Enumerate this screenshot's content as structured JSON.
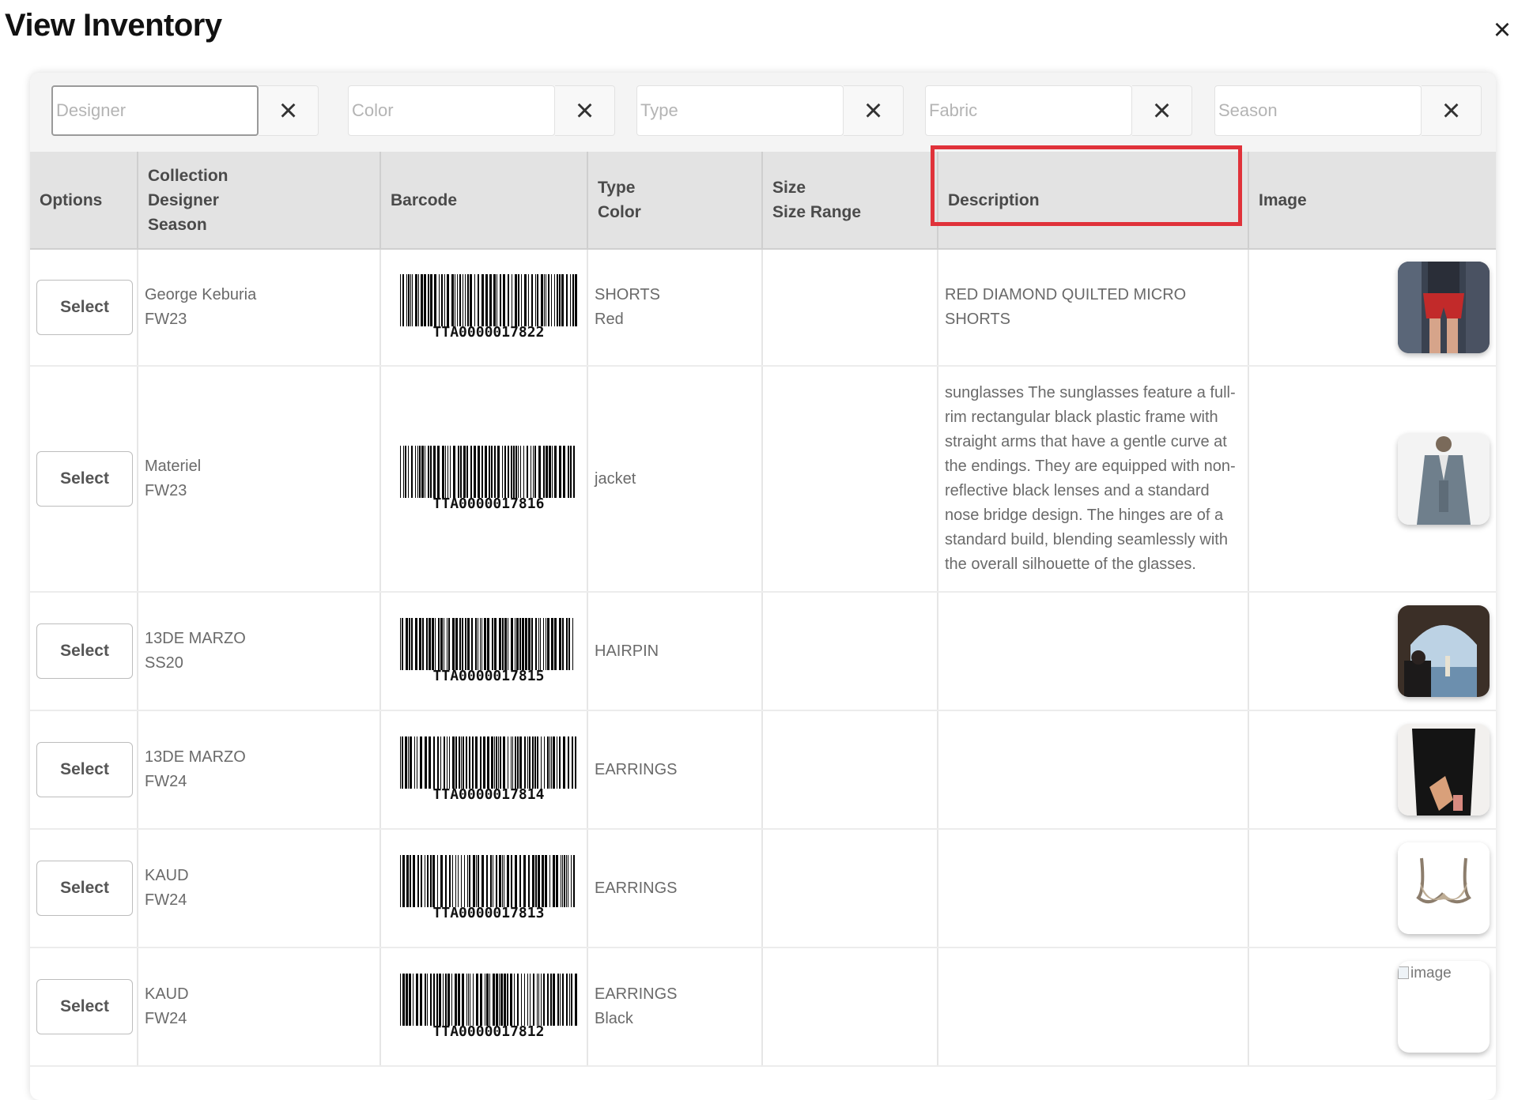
{
  "dialog": {
    "title": "View Inventory",
    "close_icon": "×"
  },
  "filters": [
    {
      "placeholder": "Designer",
      "clear_icon": "×",
      "active": true
    },
    {
      "placeholder": "Color",
      "clear_icon": "×"
    },
    {
      "placeholder": "Type",
      "clear_icon": "×"
    },
    {
      "placeholder": "Fabric",
      "clear_icon": "×",
      "highlighted": true
    },
    {
      "placeholder": "Season",
      "clear_icon": "×"
    }
  ],
  "table": {
    "headers": {
      "options": "Options",
      "collection": [
        "Collection",
        "Designer",
        "Season"
      ],
      "barcode": "Barcode",
      "type_color": [
        "Type",
        "Color"
      ],
      "size": [
        "Size",
        "Size Range"
      ],
      "description": "Description",
      "image": "Image"
    },
    "select_label": "Select",
    "rows": [
      {
        "designer": "George Keburia",
        "season": "FW23",
        "barcode": "TTA0000017822",
        "type": "SHORTS",
        "color": "Red",
        "description": "RED DIAMOND QUILTED MICRO SHORTS",
        "image": "runway-red-shorts"
      },
      {
        "designer": "Materiel",
        "season": "FW23",
        "barcode": "TTA0000017816",
        "type": "jacket",
        "color": "",
        "description": "sunglasses The sunglasses feature a full-rim rectangular black plastic frame with straight arms that have a gentle curve at the endings. They are equipped with non-reflective black lenses and a standard nose bridge design. The hinges are of a standard build, blending seamlessly with the overall silhouette of the glasses.",
        "image": "grey-blazer-model"
      },
      {
        "designer": "13DE MARZO",
        "season": "SS20",
        "barcode": "TTA0000017815",
        "type": "HAIRPIN",
        "color": "",
        "description": "",
        "image": "arch-seaside-photo"
      },
      {
        "designer": "13DE MARZO",
        "season": "FW24",
        "barcode": "TTA0000017814",
        "type": "EARRINGS",
        "color": "",
        "description": "",
        "image": "dark-garment-photo"
      },
      {
        "designer": "KAUD",
        "season": "FW24",
        "barcode": "TTA0000017813",
        "type": "EARRINGS",
        "color": "",
        "description": "",
        "image": "beige-bra-top"
      },
      {
        "designer": "KAUD",
        "season": "FW24",
        "barcode": "TTA0000017812",
        "type": "EARRINGS",
        "color": "Black",
        "description": "",
        "image": "broken-image",
        "image_alt": "image"
      }
    ]
  },
  "colors": {
    "highlight": "#e0323a",
    "header_bg": "#e3e3e3",
    "filter_bar_bg": "#f4f4f4"
  }
}
